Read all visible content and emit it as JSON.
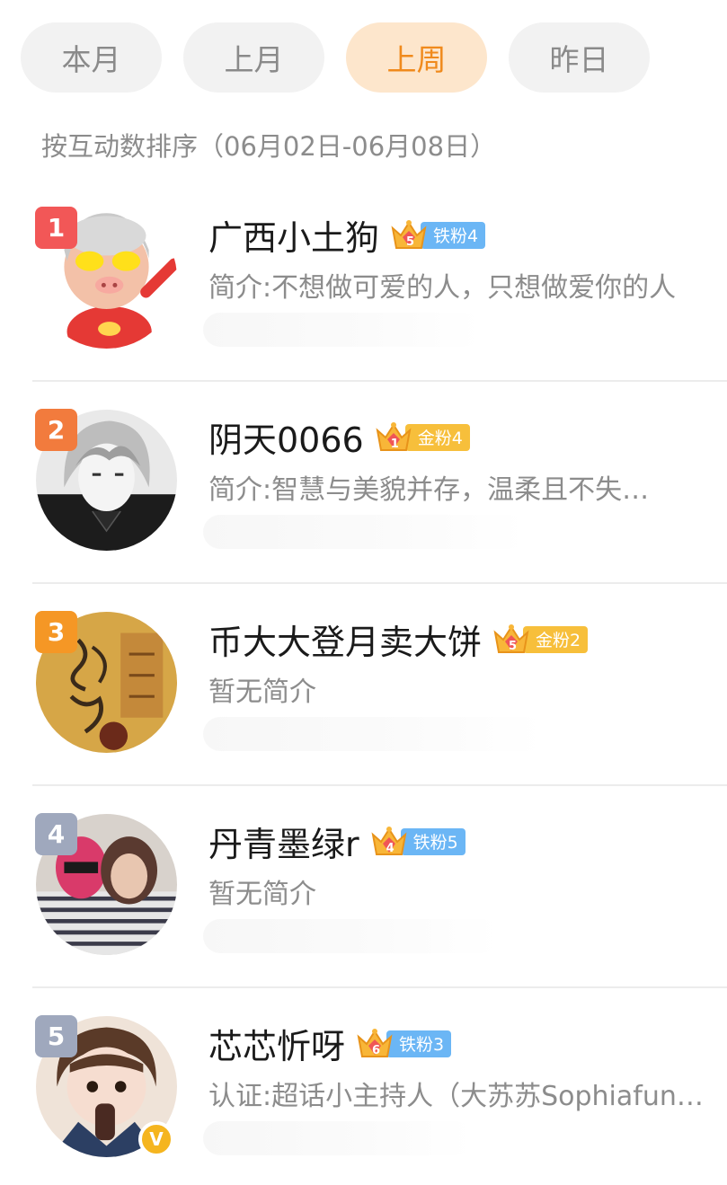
{
  "tabs": [
    {
      "label": "本月",
      "active": false
    },
    {
      "label": "上月",
      "active": false
    },
    {
      "label": "上周",
      "active": true
    },
    {
      "label": "昨日",
      "active": false
    }
  ],
  "sort_label": "按互动数排序（06月02日-06月08日）",
  "rankings": [
    {
      "rank": "1",
      "name": "广西小土狗",
      "crown_level": "5",
      "fan_badge": "铁粉4",
      "badge_type": "iron",
      "desc": "简介:不想做可爱的人，只想做爱你的人",
      "avatar": "pig-mascot-avatar"
    },
    {
      "rank": "2",
      "name": "阴天0066",
      "crown_level": "1",
      "fan_badge": "金粉4",
      "badge_type": "gold",
      "desc": "简介:智慧与美貌并存，温柔且不失…",
      "avatar": "anime-boy-avatar"
    },
    {
      "rank": "3",
      "name": "币大大登月卖大饼",
      "crown_level": "5",
      "fan_badge": "金粉2",
      "badge_type": "gold",
      "desc": "暂无简介",
      "avatar": "calligraphy-avatar"
    },
    {
      "rank": "4",
      "name": "丹青墨绿r",
      "crown_level": "4",
      "fan_badge": "铁粉5",
      "badge_type": "iron",
      "desc": "暂无简介",
      "avatar": "couple-photo-avatar"
    },
    {
      "rank": "5",
      "name": "芯芯忻呀",
      "crown_level": "6",
      "fan_badge": "铁粉3",
      "badge_type": "iron",
      "desc": "认证:超话小主持人（大苏苏Sophiafun…",
      "avatar": "child-photo-avatar",
      "verified": "V"
    }
  ],
  "colors": {
    "accent": "#f08a1c",
    "tab_active_bg": "#fde6cc",
    "rank1": "#f25757",
    "rank2": "#f27b3d",
    "rank3": "#f59725",
    "rank_other": "#9fa8bd",
    "iron_badge": "#6bb6f5",
    "gold_badge": "#f7bf3b"
  }
}
